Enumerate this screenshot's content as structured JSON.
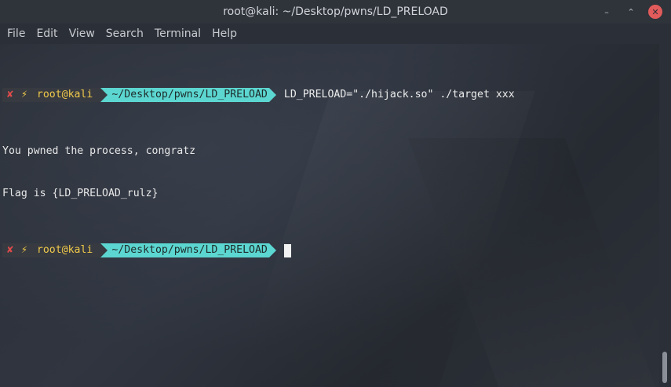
{
  "window": {
    "title": "root@kali: ~/Desktop/pwns/LD_PRELOAD",
    "controls": {
      "minimize": "–",
      "maximize": "⌃",
      "close": "✕"
    }
  },
  "menubar": {
    "items": [
      "File",
      "Edit",
      "View",
      "Search",
      "Terminal",
      "Help"
    ]
  },
  "terminal": {
    "prompt1": {
      "status_icon": "✘",
      "bolt_icon": "⚡",
      "user": "root@kali",
      "cwd": "~/Desktop/pwns/LD_PRELOAD",
      "command": "LD_PRELOAD=\"./hijack.so\" ./target xxx"
    },
    "output": [
      "You pwned the process, congratz",
      "Flag is {LD_PRELOAD_rulz}"
    ],
    "prompt2": {
      "status_icon": "✘",
      "bolt_icon": "⚡",
      "user": "root@kali",
      "cwd": "~/Desktop/pwns/LD_PRELOAD",
      "command": ""
    }
  },
  "colors": {
    "prompt_bg": "#373a40",
    "prompt_user": "#f0c94a",
    "prompt_error": "#e04b4b",
    "prompt_dir_bg": "#5cd6d0",
    "terminal_text": "#e8e8e8"
  }
}
